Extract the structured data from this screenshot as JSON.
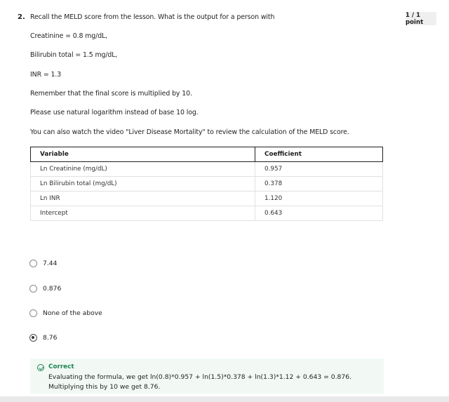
{
  "question": {
    "number": "2.",
    "score": "1 / 1 point",
    "lines": [
      "Recall the MELD score from the lesson. What is the output for a person with",
      "Creatinine = 0.8 mg/dL,",
      "Bilirubin total = 1.5 mg/dL,",
      "INR = 1.3",
      "Remember that the final score is multiplied by 10.",
      "Please use natural logarithm instead of base 10 log.",
      "You can also watch the video \"Liver Disease Mortality\" to review the calculation of the MELD score."
    ]
  },
  "table": {
    "headers": [
      "Variable",
      "Coefficient"
    ],
    "rows": [
      [
        "Ln Creatinine (mg/dL)",
        "0.957"
      ],
      [
        "Ln Bilirubin total (mg/dL)",
        "0.378"
      ],
      [
        "Ln INR",
        "1.120"
      ],
      [
        "Intercept",
        "0.643"
      ]
    ]
  },
  "options": [
    {
      "label": "7.44",
      "selected": false
    },
    {
      "label": "0.876",
      "selected": false
    },
    {
      "label": "None of the above",
      "selected": false
    },
    {
      "label": "8.76",
      "selected": true
    }
  ],
  "feedback": {
    "title": "Correct",
    "text": "Evaluating the formula, we get ln(0.8)*0.957 + ln(1.5)*0.378 + ln(1.3)*1.12 + 0.643 = 0.876. Multiplying this by 10 we get 8.76.",
    "color": "#1f8354",
    "icon": "check-circle-icon"
  }
}
